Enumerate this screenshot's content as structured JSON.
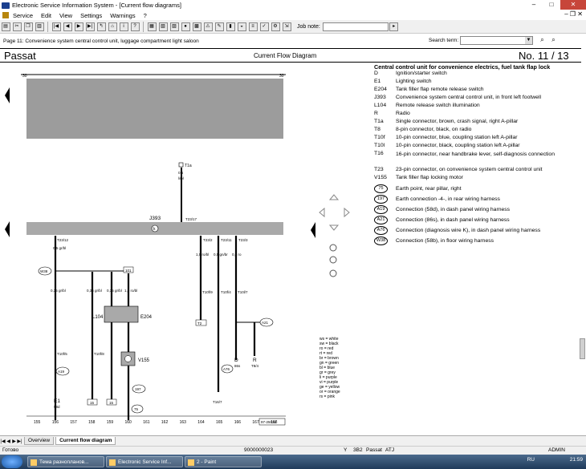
{
  "window": {
    "title": "Electronic Service Information System - [Current flow diagrams]"
  },
  "menu": {
    "items": [
      "Service",
      "Edit",
      "View",
      "Settings",
      "Warnings",
      "?"
    ]
  },
  "toolbar": {
    "job_note_label": "Job note:",
    "job_note_value": ""
  },
  "page_line": {
    "info": "Page 11: Convenience system central control unit, luggage compartment light saloon",
    "search_label": "Search term:",
    "search_value": ""
  },
  "header": {
    "model": "Passat",
    "diagram_title": "Current Flow Diagram",
    "page_number": "No.  11 / 13"
  },
  "legend": {
    "title": "Central control unit for convenience electrics, fuel tank flap lock",
    "items": [
      {
        "code": "D",
        "desc": "Ignition/starter switch"
      },
      {
        "code": "E1",
        "desc": "Lighting switch"
      },
      {
        "code": "E204",
        "desc": "Tank filler flap remote release switch"
      },
      {
        "code": "J393",
        "desc": "Convenience system central control unit, in front left footwell"
      },
      {
        "code": "L104",
        "desc": "Remote release switch illumination"
      },
      {
        "code": "R",
        "desc": "Radio"
      },
      {
        "code": "T1a",
        "desc": "Single connector, brown, crash signal, right A-pillar"
      },
      {
        "code": "T8",
        "desc": "8-pin connector, black, on radio"
      },
      {
        "code": "T10f",
        "desc": "10-pin connector, blue, coupling station left A-pillar"
      },
      {
        "code": "T10l",
        "desc": "10-pin connector, black, coupling station left A-pillar"
      },
      {
        "code": "T16",
        "desc": "16-pin connector, near handbrake lever, self-diagnosis connection"
      },
      {
        "code": "T23",
        "desc": "23-pin connector, on convenience system central control unit"
      },
      {
        "code": "V155",
        "desc": "Tank filler flap locking motor"
      }
    ],
    "circle_items": [
      {
        "code": "75",
        "desc": "Earth point, rear pillar, right"
      },
      {
        "code": "197",
        "desc": "Earth connection -4-, in rear wiring harness"
      },
      {
        "code": "A19",
        "desc": "Connection (58d), in dash panel wiring harness"
      },
      {
        "code": "A21",
        "desc": "Connection (86s), in dash panel wiring harness"
      },
      {
        "code": "A76",
        "desc": "Connection (diagnosis wire K), in dash panel wiring harness"
      },
      {
        "code": "W38",
        "desc": "Connection (58b), in floor wiring harness"
      }
    ]
  },
  "color_key": [
    "ws = white",
    "sw = black",
    "ro = red",
    "rt = red",
    "br = brown",
    "gn = green",
    "bl = blue",
    "gr = grey",
    "li = purple",
    "vi = purple",
    "ge = yellow",
    "or = orange",
    "rs = pink"
  ],
  "diagram": {
    "top_numbers": [
      "30",
      "30"
    ],
    "j393_label": "J393",
    "k_label": "k",
    "t1a": {
      "label": "T1a",
      "wire": "0,5",
      "color": "li/bl",
      "pin": "T23/17"
    },
    "pins_top": [
      "T23/12",
      "T23/2",
      "T23/11",
      "T23/3"
    ],
    "w38": "W38",
    "wires_left": [
      "0,5 gr/bl",
      "0,35 gr/bl",
      "0,35 gr/bl",
      "0,35 gr/bl",
      "1,0 ro/bl"
    ],
    "wires_right": [
      "1,0 ro/bl",
      "0,5 gn/br",
      "0,5 ro"
    ],
    "l104": "L104",
    "e204": "E204",
    "v155": "V155",
    "box_101": "101",
    "box_t2": "T2",
    "connectors": [
      "T10f/5",
      "T10f/8",
      "T10f/9",
      "T10f/4",
      "T10l/7"
    ],
    "labels_bottom": [
      {
        "c": "E1",
        "s": "58d"
      },
      {
        "c": "D",
        "s": "86s"
      },
      {
        "c": "R",
        "s": "T8/4"
      }
    ],
    "bottom_boxes": [
      "15",
      "15",
      "16"
    ],
    "circles": [
      "A19",
      "197",
      "75",
      "A76",
      "A21"
    ],
    "t16": "T16/7",
    "wire_bottom": [
      "0,35 gr/bl",
      "0,35 br",
      "0,35 br",
      "4,0 br",
      "0,35 gn/br",
      "0,5 ro",
      "0,5 ro"
    ],
    "column_numbers": [
      "155",
      "156",
      "157",
      "158",
      "159",
      "160",
      "161",
      "162",
      "163",
      "164",
      "165",
      "166",
      "167",
      "168"
    ],
    "ref_box": "97-25031"
  },
  "tabs": {
    "items": [
      "Overview",
      "Current flow diagram"
    ]
  },
  "status": {
    "left": "Готово",
    "num": "9000000023",
    "y": "Y",
    "code": "3B2",
    "model": "Passat",
    "atj": "ATJ",
    "user": "ADMIN"
  },
  "taskbar": {
    "tasks": [
      "Тема разнопланов...",
      "Electronic Service Inf...",
      "2 - Paint"
    ],
    "lang": "RU",
    "clock": "21:59"
  },
  "colors": {
    "close_button": "#c7463a",
    "panel_grey": "#9c9c9c",
    "j393_bar": "#a9a9a9"
  }
}
